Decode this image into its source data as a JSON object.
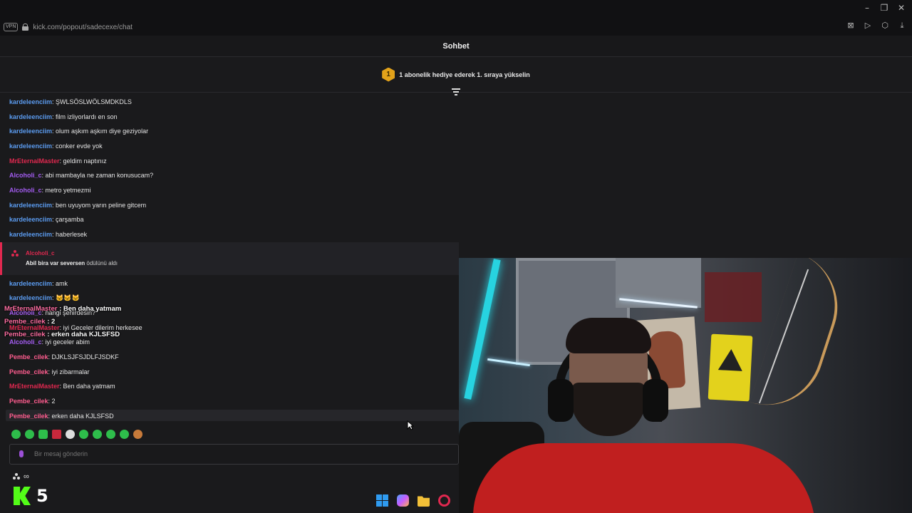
{
  "browser": {
    "vpn_label": "VPN",
    "url": "kick.com/popout/sadecexe/chat",
    "window_controls": [
      "minimize-icon",
      "restore-icon",
      "close-icon"
    ],
    "toolbar_icons": [
      "shield-icon",
      "play-icon",
      "extensions-icon",
      "download-icon"
    ]
  },
  "chat": {
    "title": "Sohbet",
    "promo": {
      "rank": "1",
      "text": "1 abonelik hediye ederek 1. sıraya yükselin"
    },
    "messages": [
      {
        "user": "kardeleenciim",
        "color": "#5b9bef",
        "text": ": ŞWLSÖSLWÖLSMDKDLS"
      },
      {
        "user": "kardeleenciim",
        "color": "#5b9bef",
        "text": ": film izliyorlardı en son"
      },
      {
        "user": "kardeleenciim",
        "color": "#5b9bef",
        "text": ": olum aşkım aşkım diye geziyolar"
      },
      {
        "user": "kardeleenciim",
        "color": "#5b9bef",
        "text": ": conker evde yok"
      },
      {
        "user": "MrEternalMaster",
        "color": "#e0284f",
        "text": ": geldim naptınız"
      },
      {
        "user": "Alcoholi_c",
        "color": "#a35cf0",
        "text": ": abi mambayla ne zaman konusucam?"
      },
      {
        "user": "Alcoholi_c",
        "color": "#a35cf0",
        "text": ": metro yetmezmi"
      },
      {
        "user": "kardeleenciim",
        "color": "#5b9bef",
        "text": ": ben uyuyom yarın peline gitcem"
      },
      {
        "user": "kardeleenciim",
        "color": "#5b9bef",
        "text": ": çarşamba"
      },
      {
        "user": "kardeleenciim",
        "color": "#5b9bef",
        "text": ": haberlesek"
      }
    ],
    "reward": {
      "user": "Alcoholi_c",
      "title": "Abil bira var seversen",
      "suffix": " ödülünü aldı"
    },
    "messages_after": [
      {
        "user": "kardeleenciim",
        "color": "#5b9bef",
        "text": ": amk"
      },
      {
        "user": "kardeleenciim",
        "color": "#5b9bef",
        "text": ": 🐱🐱🐱"
      },
      {
        "user": "Alcoholi_c",
        "color": "#a35cf0",
        "text": ": hangi şehirdesin?"
      },
      {
        "user": "MrEternalMaster",
        "color": "#e0284f",
        "text": ": iyi Geceler dilerim herkesee"
      },
      {
        "user": "Alcoholi_c",
        "color": "#a35cf0",
        "text": ": iyi geceler abim"
      },
      {
        "user": "Pembe_cilek",
        "color": "#ff5d8f",
        "text": ": DJKLSJFSJDLFJSDKF"
      },
      {
        "user": "Pembe_cilek",
        "color": "#ff5d8f",
        "text": ": iyi zibarmalar"
      },
      {
        "user": "MrEternalMaster",
        "color": "#e0284f",
        "text": ": Ben daha yatmam"
      },
      {
        "user": "Pembe_cilek",
        "color": "#ff5d8f",
        "text": ": 2"
      },
      {
        "user": "Pembe_cilek",
        "color": "#ff5d8f",
        "text": ": erken daha KJLSFSD"
      }
    ],
    "overlay": [
      {
        "user": "MrEternalMaster",
        "text": " : Ben daha yatmam"
      },
      {
        "user": "Pembe_cilek",
        "text": " : 2"
      },
      {
        "user": "Pembe_cilek",
        "text": " : erken daha KJLSFSD"
      }
    ],
    "input_placeholder": "Bir mesaj gönderin",
    "sub_count": "∞",
    "emotes": [
      "emote-1",
      "emote-2",
      "emote-3",
      "emote-4",
      "emote-5",
      "emote-6",
      "emote-7",
      "emote-8",
      "emote-9",
      "emote-10"
    ]
  },
  "overlay_logo": {
    "number": "5"
  },
  "taskbar": [
    "windows-start-icon",
    "copilot-icon",
    "file-explorer-icon",
    "opera-browser-icon"
  ]
}
